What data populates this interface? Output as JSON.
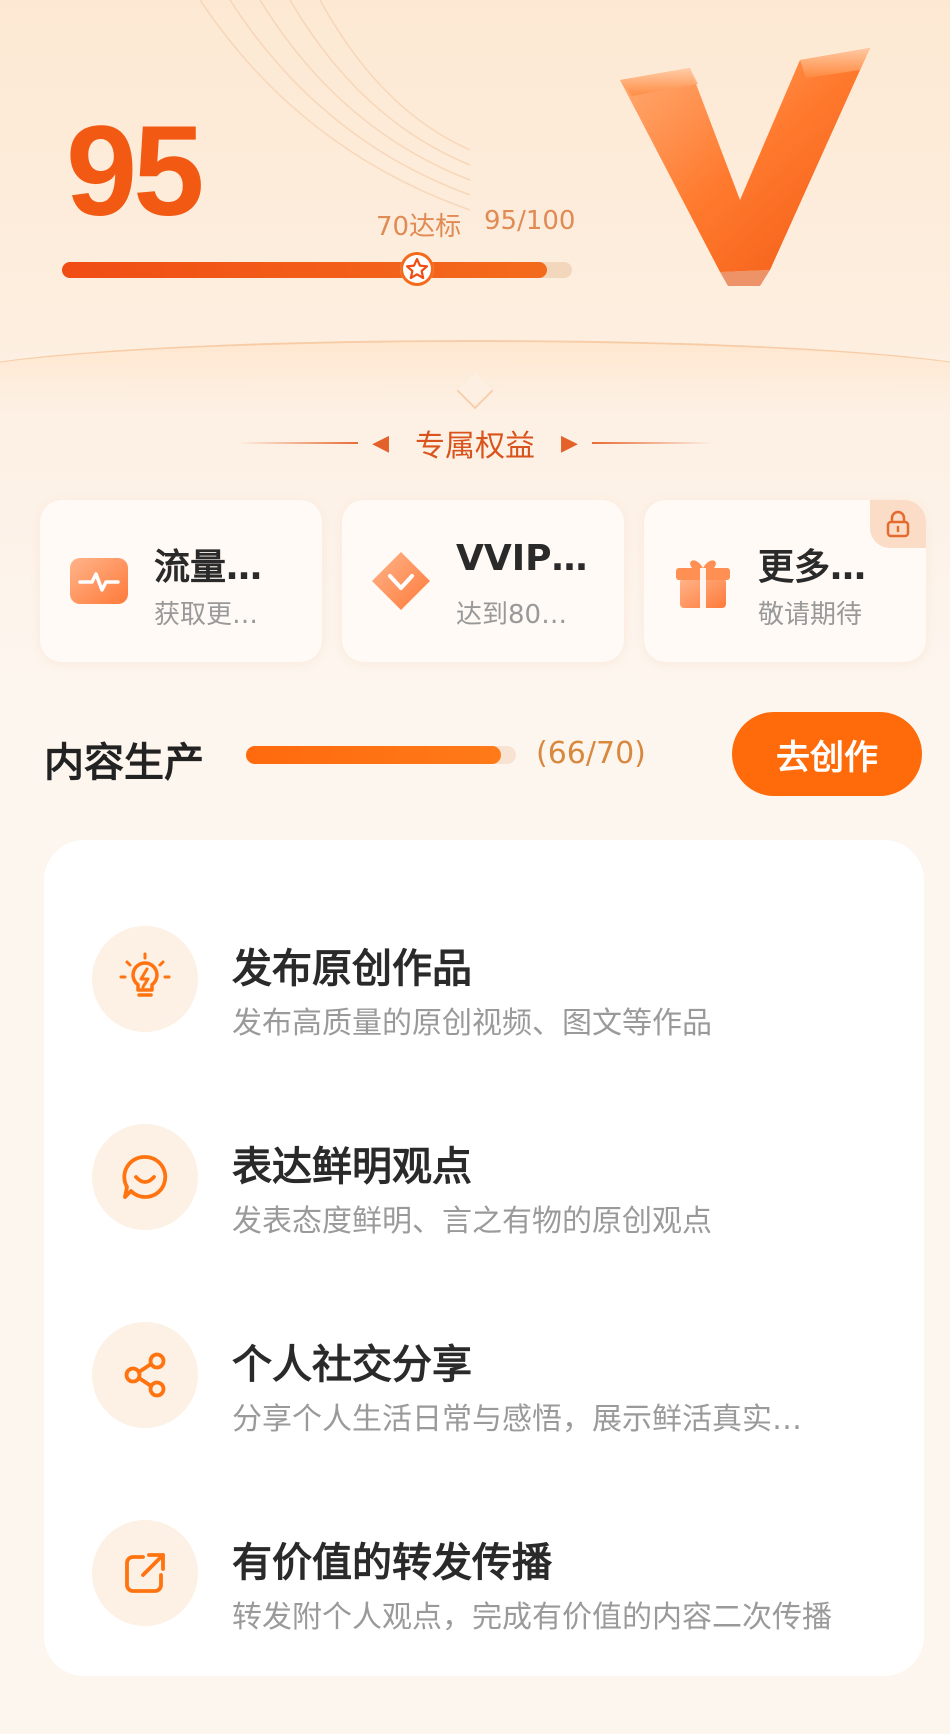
{
  "header": {
    "score": "95",
    "target_label": "70达标",
    "progress_label": "95/100",
    "score_fraction": 0.95,
    "colors": {
      "accent": "#f25a14",
      "track": "#f3d7bd"
    }
  },
  "benefits": {
    "title": "专属权益",
    "items": [
      {
        "title": "流量…",
        "subtitle": "获取更…",
        "icon": "traffic-pulse-icon",
        "locked": false
      },
      {
        "title": "VVIP…",
        "subtitle": "达到80…",
        "icon": "diamond-icon",
        "locked": false
      },
      {
        "title": "更多…",
        "subtitle": "敬请期待",
        "icon": "gift-icon",
        "locked": true
      }
    ]
  },
  "content_section": {
    "title": "内容生产",
    "progress_text": "(66/70)",
    "progress_fraction": 0.943,
    "button_label": "去创作"
  },
  "tasks": [
    {
      "title": "发布原创作品",
      "description": "发布高质量的原创视频、图文等作品",
      "icon": "lightbulb-icon"
    },
    {
      "title": "表达鲜明观点",
      "description": "发表态度鲜明、言之有物的原创观点",
      "icon": "chat-smile-icon"
    },
    {
      "title": "个人社交分享",
      "description": "分享个人生活日常与感悟，展示鲜活真实…",
      "icon": "share-icon"
    },
    {
      "title": "有价值的转发传播",
      "description": "转发附个人观点，完成有价值的内容二次传播",
      "icon": "forward-icon"
    }
  ]
}
